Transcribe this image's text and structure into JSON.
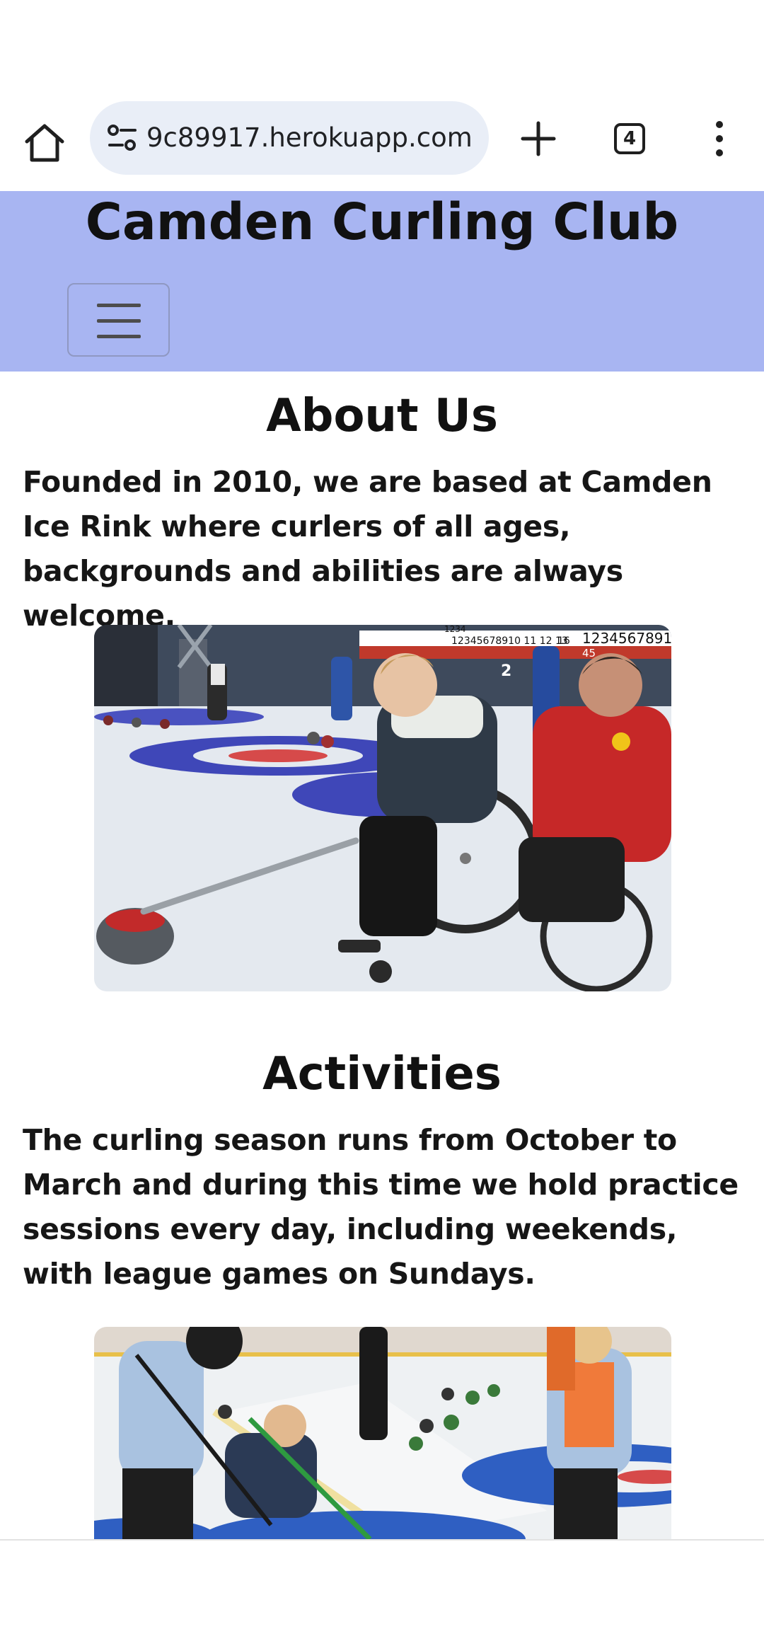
{
  "browser": {
    "url": "9c89917.herokuapp.com",
    "tab_count": "4",
    "icons": [
      "home-icon",
      "site-info-icon",
      "new-tab-icon",
      "tab-switcher-icon",
      "more-menu-icon"
    ]
  },
  "header": {
    "title": "Camden Curling Club",
    "background": "#a8b5f2",
    "menu_icon": "hamburger-icon"
  },
  "about": {
    "heading": "About Us",
    "text": "Founded in 2010, we are based at Camden Ice Rink where curlers of all ages, backgrounds and abilities are always welcome."
  },
  "activities": {
    "heading": "Activities",
    "text": "The curling season runs from October to March and during this time we hold practice sessions every day, including weekends, with league games on Sundays."
  },
  "scoreboard": {
    "left": "1234",
    "mid_numbers": "12345678910 11 12 13",
    "mid_code": "16",
    "right_numbers": "1234567891",
    "right_lower": "45",
    "lane_number": "2"
  }
}
